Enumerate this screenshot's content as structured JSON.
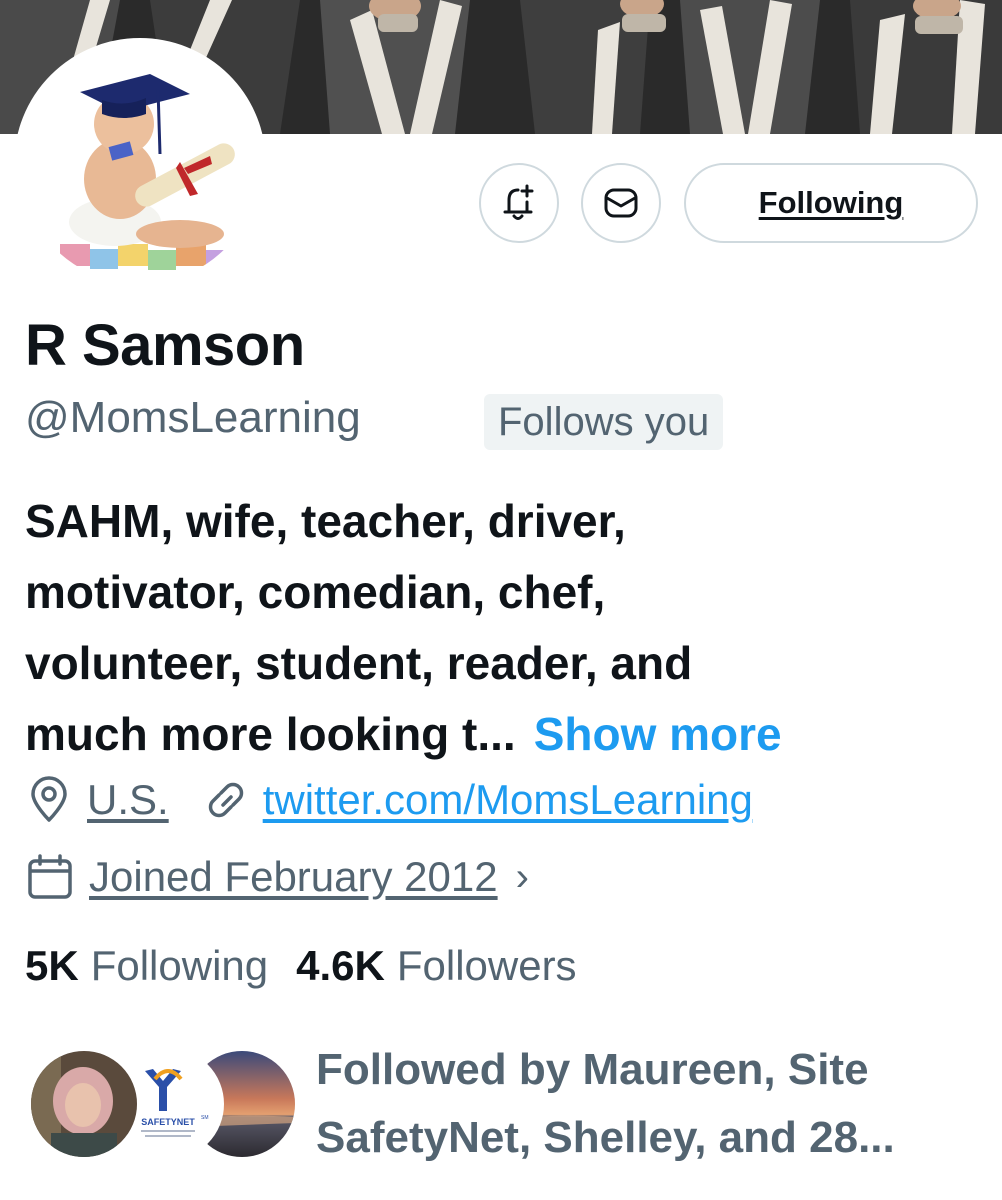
{
  "profile": {
    "display_name": "R Samson",
    "handle": "@MomsLearning",
    "follows_you_badge": "Follows you"
  },
  "actions": {
    "notify_icon": "bell-plus-icon",
    "message_icon": "envelope-icon",
    "following_label": "Following"
  },
  "bio": {
    "lines": [
      "SAHM, wife, teacher, driver,",
      "motivator, comedian, chef,",
      "volunteer, student, reader, and",
      "much more looking t..."
    ],
    "show_more_label": "Show more"
  },
  "meta": {
    "location": "U.S.",
    "location_icon": "map-pin-icon",
    "website": "twitter.com/MomsLearning",
    "website_icon": "link-icon",
    "joined": "Joined February 2012",
    "joined_icon": "calendar-icon",
    "joined_chevron": "›"
  },
  "stats": {
    "following_count": "5K",
    "following_label": "Following",
    "followers_count": "4.6K",
    "followers_label": "Followers"
  },
  "followed_by": {
    "lines": [
      "Followed by Maureen, Site",
      "SafetyNet, Shelley, and 28..."
    ],
    "avatars": [
      {
        "name": "Maureen"
      },
      {
        "name": "SafetyNet",
        "logo_text": "SAFETYNET",
        "logo_mark": "SM"
      },
      {
        "name": "Shelley"
      }
    ]
  },
  "colors": {
    "text_primary": "#0f1419",
    "text_secondary": "#536471",
    "accent_blue": "#1d9bf0",
    "border": "#cfd9de",
    "badge_bg": "#eff3f4"
  }
}
